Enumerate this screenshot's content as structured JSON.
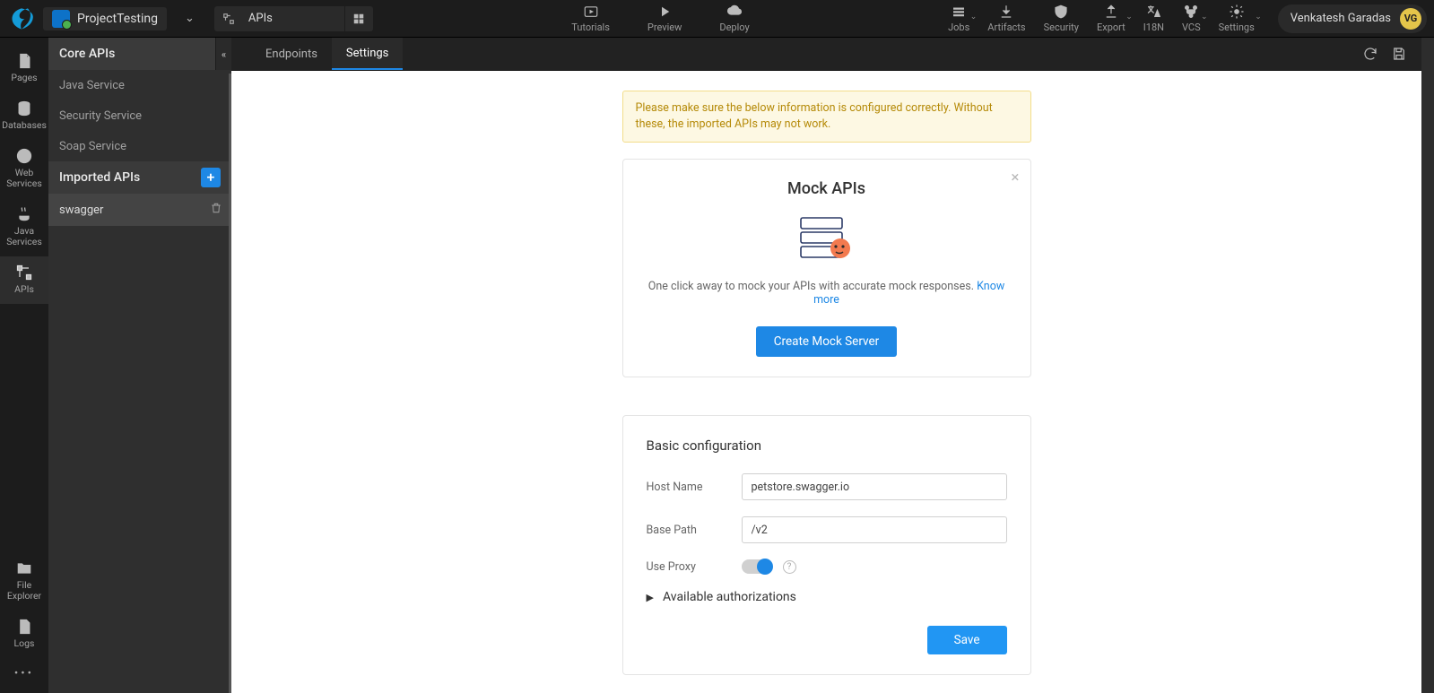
{
  "project": {
    "name": "ProjectTesting"
  },
  "apis_pill": {
    "label": "APIs"
  },
  "top_actions": {
    "tutorials": "Tutorials",
    "preview": "Preview",
    "deploy": "Deploy"
  },
  "top_right": {
    "jobs": "Jobs",
    "artifacts": "Artifacts",
    "security": "Security",
    "export": "Export",
    "i18n": "I18N",
    "vcs": "VCS",
    "settings": "Settings"
  },
  "user": {
    "name": "Venkatesh Garadas",
    "initials": "VG"
  },
  "rail": {
    "pages": "Pages",
    "databases": "Databases",
    "web_services": "Web Services",
    "java_services": "Java Services",
    "apis": "APIs",
    "file_explorer": "File Explorer",
    "logs": "Logs"
  },
  "sidepanel": {
    "core_header": "Core APIs",
    "core_items": [
      "Java Service",
      "Security Service",
      "Soap Service"
    ],
    "imported_header": "Imported APIs",
    "imported_items": [
      "swagger"
    ]
  },
  "tabs": {
    "endpoints": "Endpoints",
    "settings": "Settings"
  },
  "alert_text": "Please make sure the below information is configured correctly. Without these, the imported APIs may not work.",
  "mock_panel": {
    "title": "Mock APIs",
    "subtitle": "One click away to mock your APIs with accurate mock responses. ",
    "know_more": "Know more",
    "button": "Create Mock Server"
  },
  "basic": {
    "title": "Basic configuration",
    "host_label": "Host Name",
    "host_value": "petstore.swagger.io",
    "basepath_label": "Base Path",
    "basepath_value": "/v2",
    "proxy_label": "Use Proxy",
    "auth_label": "Available authorizations",
    "save": "Save"
  }
}
